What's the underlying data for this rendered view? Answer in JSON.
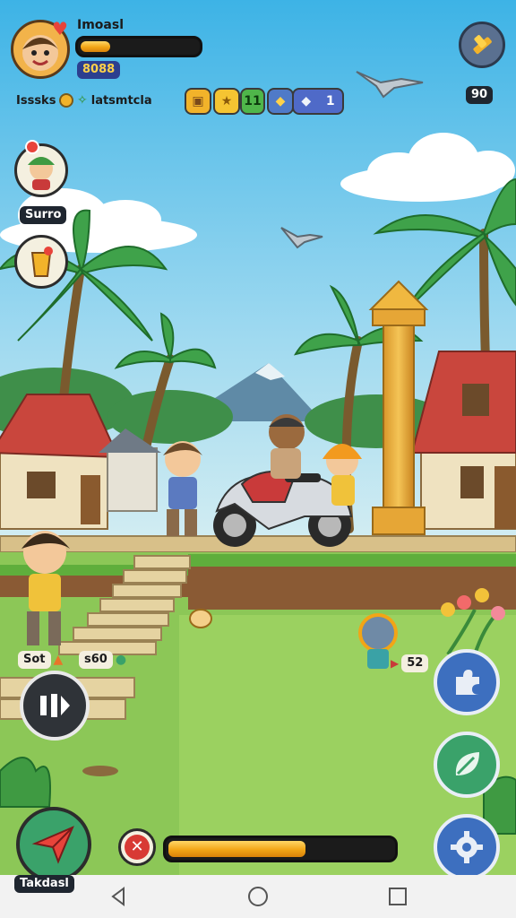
{
  "player": {
    "name": "Imoasl",
    "health_fraction": 0.25,
    "coins": "8088"
  },
  "stats": {
    "left_label": "Isssks",
    "right_label": "latsmtcla"
  },
  "resources": {
    "green_value": "11",
    "blue_value": "1",
    "top_right_value": "90"
  },
  "quests": {
    "quest_label": "Surro"
  },
  "characters": {
    "left_label": "Sot",
    "middle_label": "s60",
    "enemy_label": "52"
  },
  "action": {
    "main_label": "Takdasl",
    "progress_fraction": 0.61
  },
  "colors": {
    "bar_fill": "#f2a516",
    "sky": "#8fd3ef",
    "grass": "#8cc757",
    "roof": "#c9463d",
    "button_blue": "#3d6fbf",
    "button_green": "#3aa26a",
    "close_red": "#d83a34"
  },
  "icons": {
    "top_right": "hammer-icon",
    "left_controls": "pause-icon",
    "main_action": "paper-plane-icon",
    "close": "close-icon",
    "right_1": "puzzle-icon",
    "right_2": "leaf-icon",
    "right_3": "gear-icon",
    "nav_back": "back-icon",
    "nav_home": "home-icon",
    "nav_recent": "recents-icon"
  }
}
